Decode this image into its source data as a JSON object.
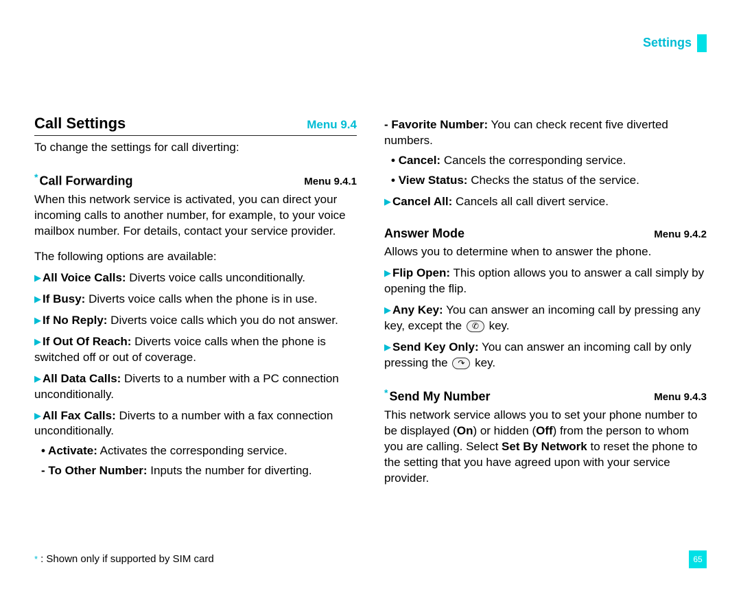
{
  "header": {
    "section": "Settings"
  },
  "page_number": "65",
  "footnote": ": Shown only if supported by SIM card",
  "left": {
    "h1": {
      "title": "Call Settings",
      "menu": "Menu 9.4"
    },
    "intro": "To change the settings for call diverting:",
    "call_forwarding": {
      "title": "Call Forwarding",
      "menu": "Menu 9.4.1",
      "body1": "When this network service is activated, you can direct your incoming calls to another number, for example, to your voice mailbox number. For details, contact your service provider.",
      "body2": "The following options are available:",
      "options": {
        "all_voice": {
          "label": "All Voice Calls:",
          "text": " Diverts voice calls unconditionally."
        },
        "if_busy": {
          "label": "If Busy:",
          "text": " Diverts voice calls when the phone is in use."
        },
        "if_no_reply": {
          "label": "If No Reply:",
          "text": " Diverts voice calls which you do not answer."
        },
        "if_out": {
          "label": "If Out Of Reach:",
          "text": " Diverts voice calls when the phone is switched off or out of coverage."
        },
        "all_data": {
          "label": "All Data Calls:",
          "text": " Diverts to a number with a PC connection unconditionally."
        },
        "all_fax": {
          "label": "All Fax Calls:",
          "text": " Diverts to a number with a fax connection unconditionally."
        }
      },
      "sub": {
        "activate": {
          "label": "Activate:",
          "text": " Activates the corresponding service."
        },
        "to_other": {
          "label": "- To Other Number:",
          "text": " Inputs the number for diverting."
        }
      }
    }
  },
  "right": {
    "fav_num": {
      "label": "- Favorite Number:",
      "text": " You can check recent five diverted numbers."
    },
    "cancel": {
      "label": "Cancel:",
      "text": " Cancels the corresponding service."
    },
    "view": {
      "label": "View Status:",
      "text": " Checks the status of the service."
    },
    "cancel_all": {
      "label": "Cancel All:",
      "text": " Cancels all call divert service."
    },
    "answer_mode": {
      "title": "Answer Mode",
      "menu": "Menu 9.4.2",
      "body": "Allows you to determine when to answer the phone.",
      "flip": {
        "label": "Flip Open:",
        "text": " This option allows you to answer a call simply by opening the flip."
      },
      "anykey_label": "Any Key:",
      "anykey_pre": " You can answer an incoming call by pressing any key, except the ",
      "anykey_post": " key.",
      "sendkey_label": "Send Key Only:",
      "sendkey_pre": " You can answer an incoming call by only pressing the ",
      "sendkey_post": " key."
    },
    "send_my_number": {
      "title": "Send My Number",
      "menu": "Menu 9.4.3",
      "pre": "This network service allows you to set your phone number to be displayed (",
      "on": "On",
      "mid1": ") or hidden (",
      "off": "Off",
      "mid2": ") from the person to whom you are calling. Select ",
      "setby": "Set By Network",
      "post": " to reset the phone to the setting that you have agreed upon with your service provider."
    }
  },
  "icons": {
    "end": "✆",
    "send": "↷"
  }
}
